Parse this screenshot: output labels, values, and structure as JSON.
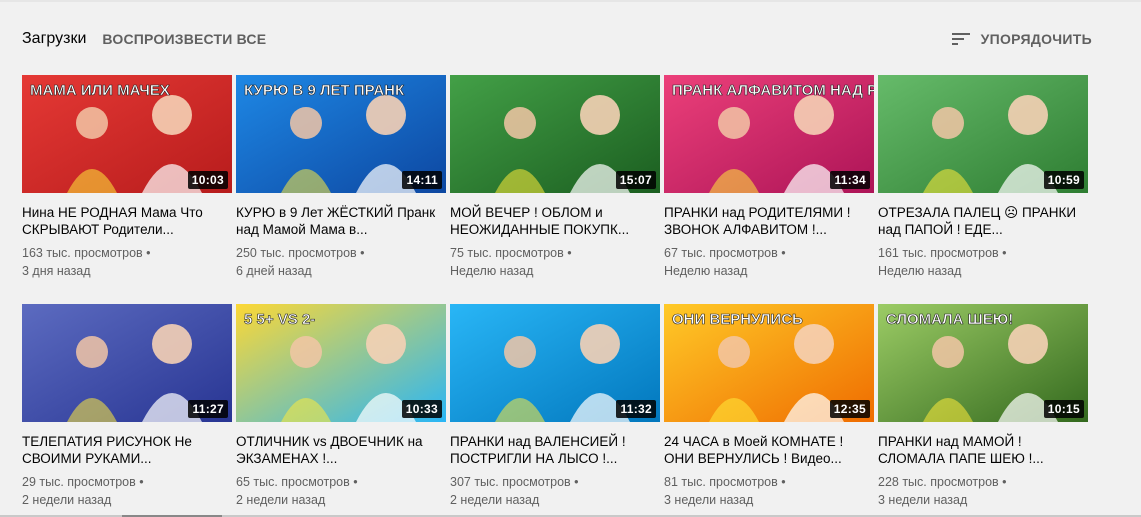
{
  "header": {
    "title": "Загрузки",
    "play_all": "ВОСПРОИЗВЕСТИ ВСЕ",
    "sort_label": "УПОРЯДОЧИТЬ",
    "sort_icon": "sort-icon"
  },
  "videos": [
    {
      "title": "Нина НЕ РОДНАЯ Мама Что СКРЫВАЮТ Родители...",
      "views": "163 тыс. просмотров",
      "date": "3 дня назад",
      "duration": "10:03",
      "thumb_text": "МАМА ИЛИ МАЧЕХ",
      "bg1": "#e53935",
      "bg2": "#b71c1c"
    },
    {
      "title": "КУРЮ в 9 Лет ЖЁСТКИЙ Пранк над Мамой Мама в...",
      "views": "250 тыс. просмотров",
      "date": "6 дней назад",
      "duration": "14:11",
      "thumb_text": "КУРЮ В 9 ЛЕТ ПРАНК",
      "bg1": "#1e88e5",
      "bg2": "#0d47a1"
    },
    {
      "title": "МОЙ ВЕЧЕР ! ОБЛОМ и НЕОЖИДАННЫЕ ПОКУПК...",
      "views": "75 тыс. просмотров",
      "date": "Неделю назад",
      "duration": "15:07",
      "thumb_text": "",
      "bg1": "#43a047",
      "bg2": "#1b5e20"
    },
    {
      "title": "ПРАНКИ над РОДИТЕЛЯМИ ! ЗВОНОК АЛФАВИТОМ !...",
      "views": "67 тыс. просмотров",
      "date": "Неделю назад",
      "duration": "11:34",
      "thumb_text": "ПРАНК АЛФАВИТОМ НАД РОДИТЕЛЯМИ",
      "bg1": "#ec407a",
      "bg2": "#ad1457"
    },
    {
      "title": "ОТРЕЗАЛА ПАЛЕЦ ☹ ПРАНКИ над ПАПОЙ ! ЕДЕ...",
      "views": "161 тыс. просмотров",
      "date": "Неделю назад",
      "duration": "10:59",
      "thumb_text": "",
      "bg1": "#66bb6a",
      "bg2": "#2e7d32"
    },
    {
      "title": "ТЕЛЕПАТИЯ РИСУНОК Не СВОИМИ РУКАМИ...",
      "views": "29 тыс. просмотров",
      "date": "2 недели назад",
      "duration": "11:27",
      "thumb_text": "",
      "bg1": "#5c6bc0",
      "bg2": "#283593"
    },
    {
      "title": "ОТЛИЧНИК vs ДВОЕЧНИК на ЭКЗАМЕНАХ !...",
      "views": "65 тыс. просмотров",
      "date": "2 недели назад",
      "duration": "10:33",
      "thumb_text": "5 5+ VS 2-",
      "bg1": "#fdd835",
      "bg2": "#29b6f6"
    },
    {
      "title": "ПРАНКИ над ВАЛЕНСИЕЙ ! ПОСТРИГЛИ НА ЛЫСО !...",
      "views": "307 тыс. просмотров",
      "date": "2 недели назад",
      "duration": "11:32",
      "thumb_text": "",
      "bg1": "#29b6f6",
      "bg2": "#0277bd"
    },
    {
      "title": "24 ЧАСА в Моей КОМНАТЕ ! ОНИ ВЕРНУЛИСЬ ! Видео...",
      "views": "81 тыс. просмотров",
      "date": "3 недели назад",
      "duration": "12:35",
      "thumb_text": "ОНИ ВЕРНУЛИСЬ",
      "bg1": "#ffca28",
      "bg2": "#ef6c00"
    },
    {
      "title": "ПРАНКИ над МАМОЙ ! СЛОМАЛА ПАПЕ ШЕЮ !...",
      "views": "228 тыс. просмотров",
      "date": "3 недели назад",
      "duration": "10:15",
      "thumb_text": "СЛОМАЛА ШЕЮ!",
      "bg1": "#9ccc65",
      "bg2": "#33691e"
    }
  ]
}
